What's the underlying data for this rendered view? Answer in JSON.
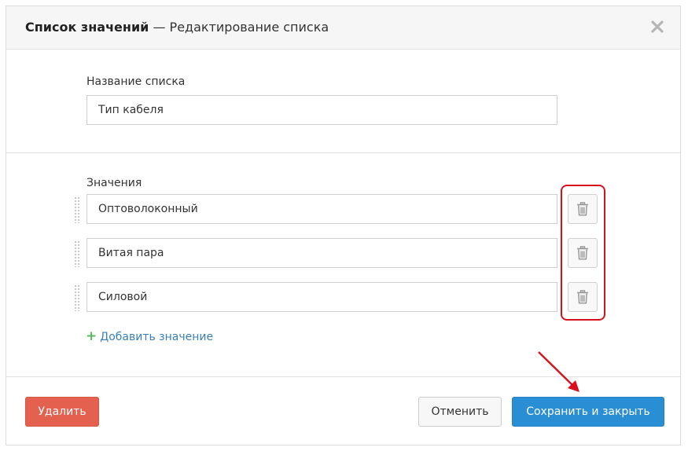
{
  "dialog": {
    "title_bold": "Список значений",
    "title_rest": " — Редактирование списка"
  },
  "list_name": {
    "label": "Название списка",
    "value": "Тип кабеля"
  },
  "values_section": {
    "label": "Значения",
    "items": [
      {
        "value": "Оптоволоконный"
      },
      {
        "value": "Витая пара"
      },
      {
        "value": "Силовой"
      }
    ],
    "add_label": "Добавить значение"
  },
  "footer": {
    "delete_label": "Удалить",
    "cancel_label": "Отменить",
    "save_label": "Сохранить и закрыть"
  },
  "icons": {
    "close": "close-icon",
    "drag": "drag-handle-icon",
    "trash": "trash-icon",
    "plus": "plus-icon"
  },
  "colors": {
    "annotation": "#d8101c",
    "delete": "#e4604f",
    "save": "#2a8ed5",
    "link": "#3a7fb5",
    "plus": "#5cb85c"
  }
}
